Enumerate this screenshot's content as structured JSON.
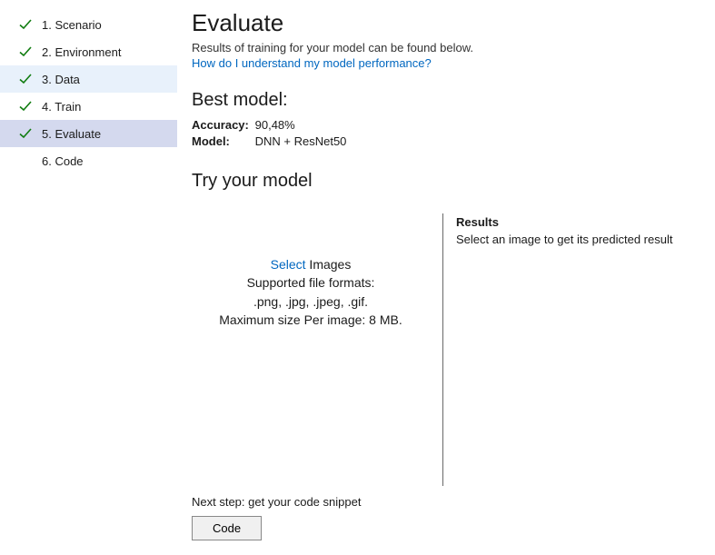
{
  "sidebar": {
    "items": [
      {
        "label": "1. Scenario",
        "checked": true,
        "state": ""
      },
      {
        "label": "2. Environment",
        "checked": true,
        "state": ""
      },
      {
        "label": "3. Data",
        "checked": true,
        "state": "hover"
      },
      {
        "label": "4. Train",
        "checked": true,
        "state": ""
      },
      {
        "label": "5. Evaluate",
        "checked": true,
        "state": "active"
      },
      {
        "label": "6. Code",
        "checked": false,
        "state": ""
      }
    ]
  },
  "main": {
    "title": "Evaluate",
    "subtitle": "Results of training for your model can be found below.",
    "help_link": "How do I understand my model performance?",
    "best_model": {
      "heading": "Best model:",
      "accuracy_label": "Accuracy:",
      "accuracy_value": "90,48%",
      "model_label": "Model:",
      "model_value": "DNN + ResNet50"
    },
    "try": {
      "heading": "Try your model",
      "select_word": "Select",
      "images_word": " Images",
      "formats_label": "Supported file formats:",
      "formats_value": ".png, .jpg, .jpeg, .gif.",
      "max_size": "Maximum size Per image: 8 MB.",
      "results_label": "Results",
      "results_text": "Select an image to get its predicted result"
    },
    "footer": {
      "next_step": "Next step: get your code snippet",
      "code_button": "Code"
    }
  }
}
